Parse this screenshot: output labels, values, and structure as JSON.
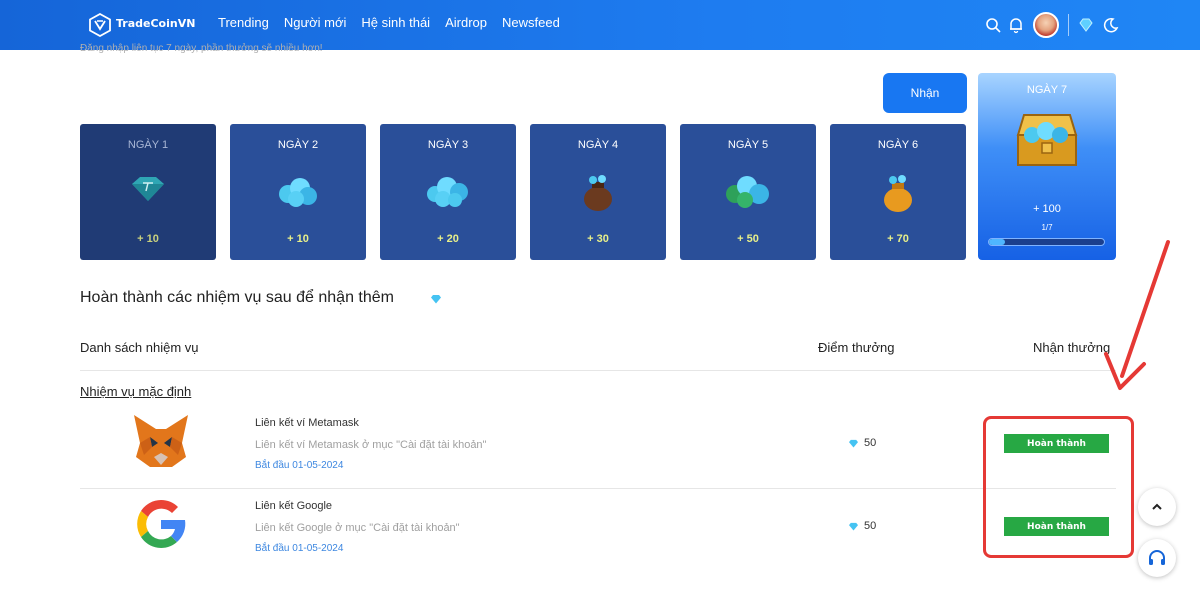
{
  "header": {
    "brand": "TradeCoinVN",
    "nav": [
      "Trending",
      "Người mới",
      "Hệ sinh thái",
      "Airdrop",
      "Newsfeed"
    ],
    "icons": [
      "search-icon",
      "bell-icon",
      "avatar",
      "diamond-icon",
      "moon-icon"
    ],
    "brand_color": "#1877f2"
  },
  "checkin": {
    "note": "Đăng nhập liên tục 7 ngày, phần thưởng sẽ nhiều hơn!",
    "claim_label": "Nhận",
    "days": [
      {
        "label": "NGÀY 1",
        "points": "+ 10"
      },
      {
        "label": "NGÀY 2",
        "points": "+ 10"
      },
      {
        "label": "NGÀY 3",
        "points": "+ 20"
      },
      {
        "label": "NGÀY 4",
        "points": "+ 30"
      },
      {
        "label": "NGÀY 5",
        "points": "+ 50"
      },
      {
        "label": "NGÀY 6",
        "points": "+ 70"
      }
    ],
    "day7": {
      "label": "NGÀY 7",
      "points": "+ 100",
      "progress_text": "1/7",
      "progress_fraction": 0.1428
    }
  },
  "tasks": {
    "section_title": "Hoàn thành các nhiệm vụ sau để nhận thêm",
    "col_list": "Danh sách nhiệm vụ",
    "col_points": "Điểm thưởng",
    "col_reward": "Nhận thưởng",
    "group_title": "Nhiệm vụ mặc định",
    "items": [
      {
        "title": "Liên kết ví Metamask",
        "desc": "Liên kết ví Metamask ở mục \"Cài đặt tài khoản\"",
        "date": "Bắt đầu 01-05-2024",
        "points": "50",
        "status": "Hoàn thành",
        "icon": "metamask-fox-icon"
      },
      {
        "title": "Liên kết Google",
        "desc": "Liên kết Google ở mục \"Cài đặt tài khoản\"",
        "date": "Bắt đầu 01-05-2024",
        "points": "50",
        "status": "Hoàn thành",
        "icon": "google-icon"
      }
    ]
  },
  "colors": {
    "annotation": "#e53935",
    "done": "#27a844",
    "card": "#2a4f99"
  }
}
